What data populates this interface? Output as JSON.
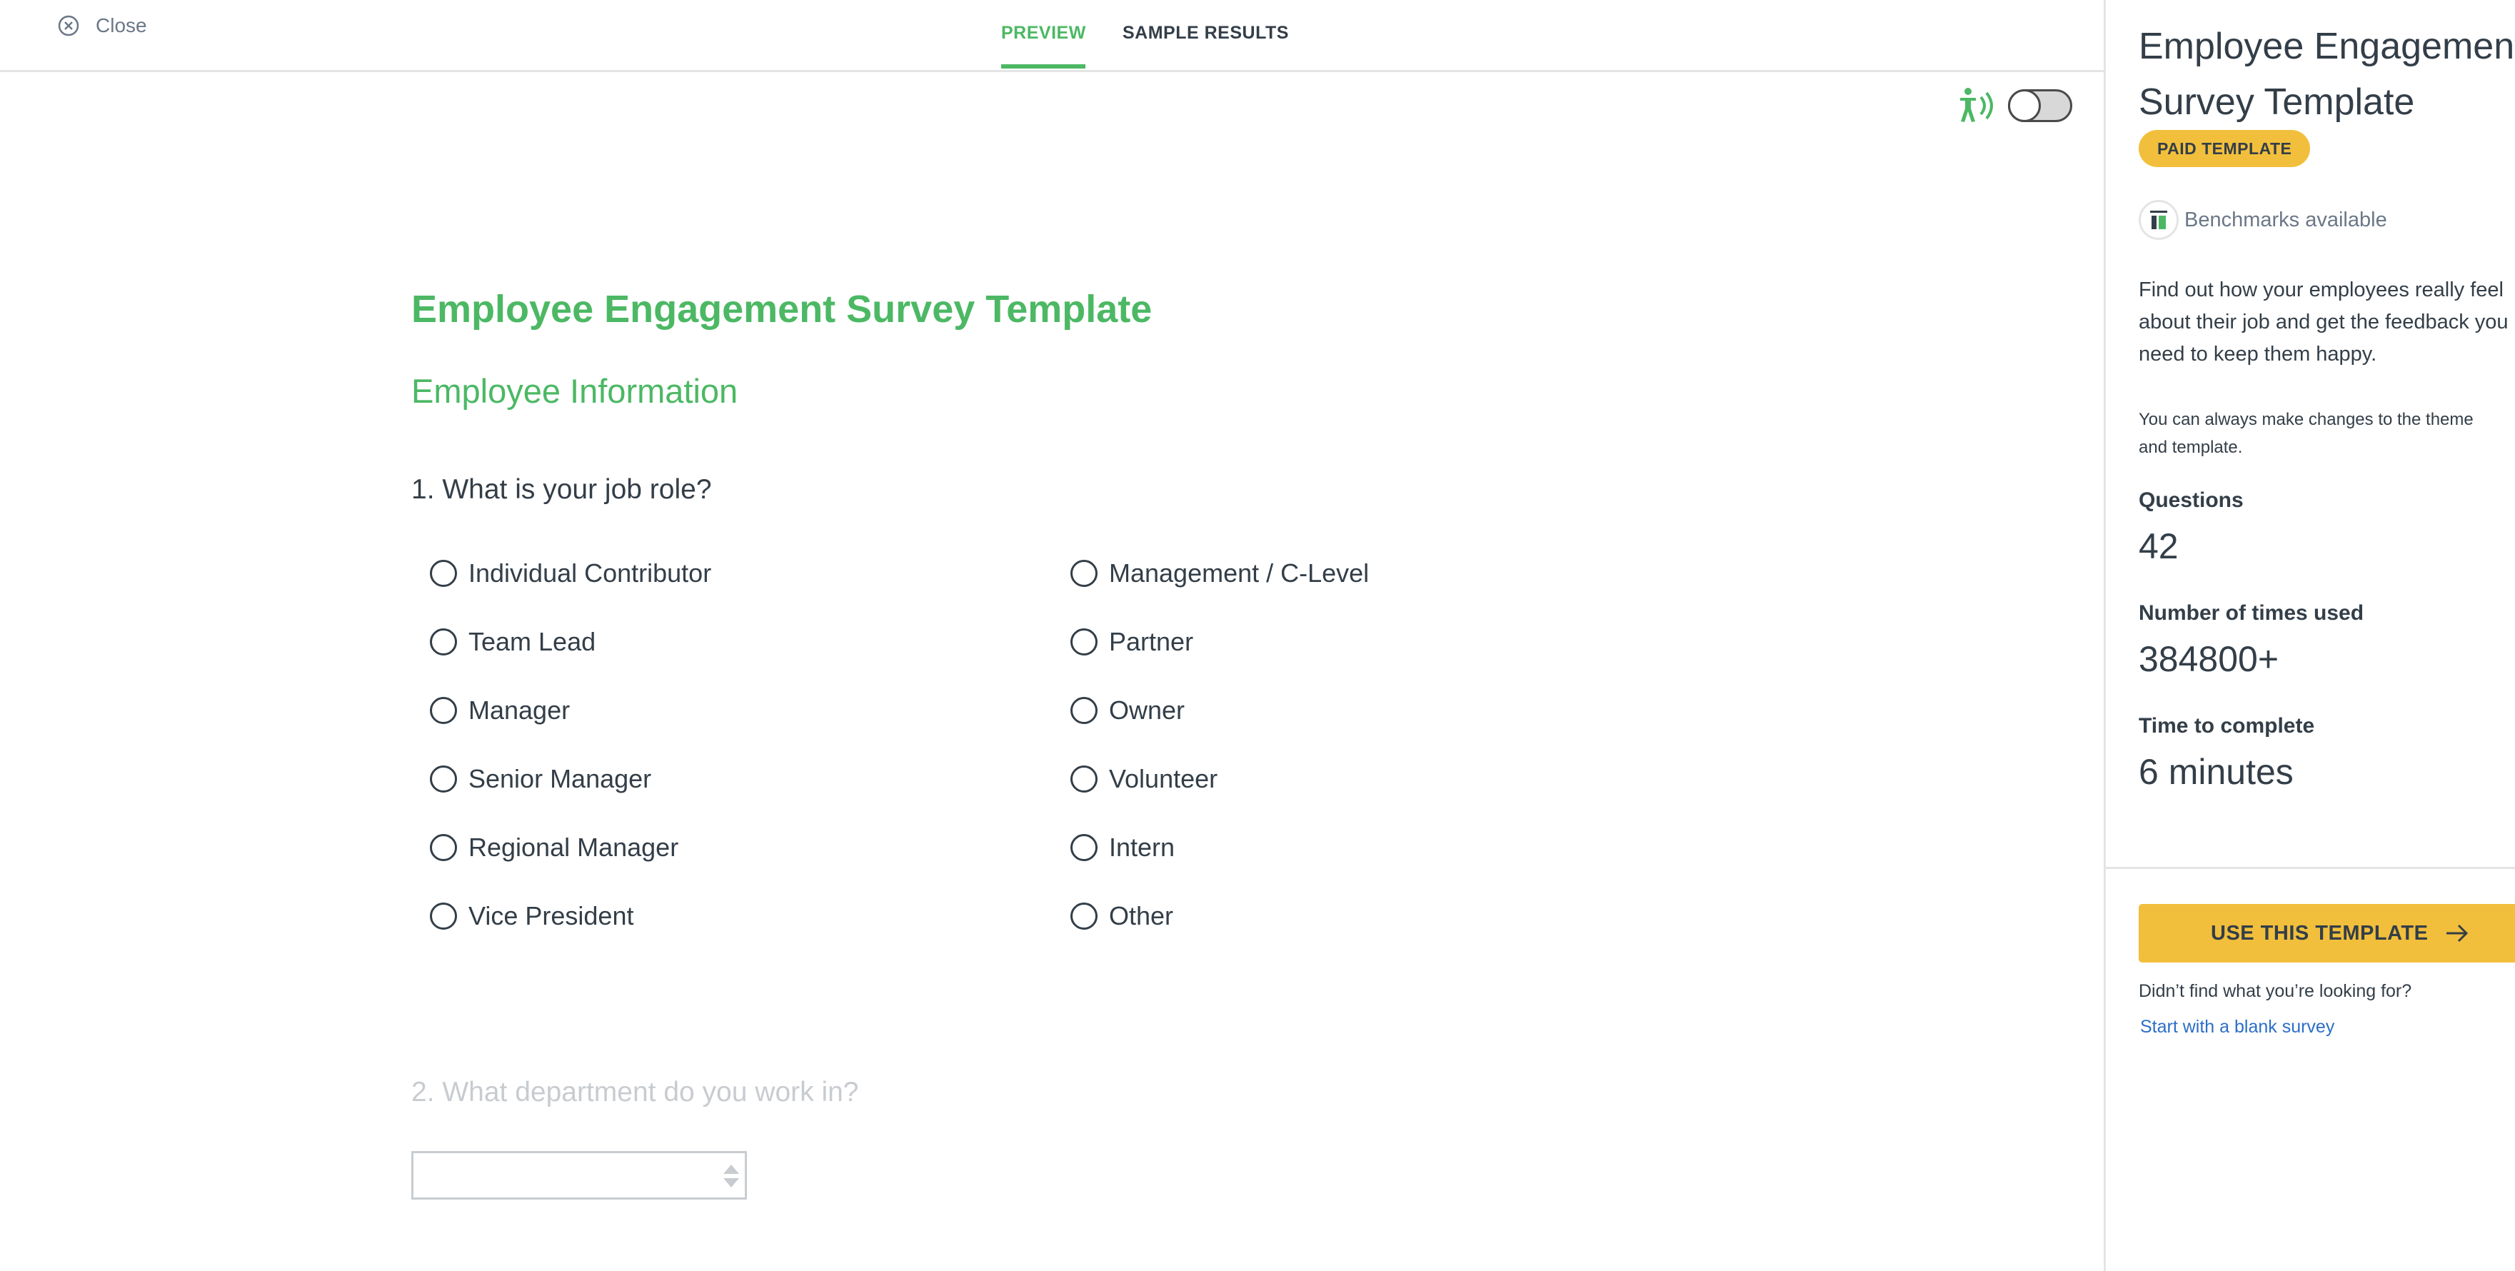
{
  "header": {
    "close_label": "Close",
    "tabs": [
      {
        "label": "PREVIEW",
        "active": true
      },
      {
        "label": "SAMPLE RESULTS",
        "active": false
      }
    ]
  },
  "accessibility": {
    "icon": "accessibility-icon",
    "toggle_on": false
  },
  "survey": {
    "title": "Employee Engagement Survey Template",
    "page_title": "Employee Information",
    "question1": {
      "text": "1. What is your job role?",
      "choices_left": [
        "Individual Contributor",
        "Team Lead",
        "Manager",
        "Senior Manager",
        "Regional Manager",
        "Vice President"
      ],
      "choices_right": [
        "Management / C-Level",
        "Partner",
        "Owner",
        "Volunteer",
        "Intern",
        "Other"
      ]
    },
    "question2": {
      "text": "2. What department do you work in?",
      "selected": ""
    }
  },
  "panel": {
    "title_line1": "Employee Engagement",
    "title_line2": "Survey Template",
    "badge": "PAID TEMPLATE",
    "benchmarks": "Benchmarks available",
    "description_lines": [
      "Find out how your employees really feel",
      "about their job and get the feedback you",
      "need to keep them happy."
    ],
    "note_lines": [
      "You can always make changes to the theme",
      "and template."
    ],
    "stats": [
      {
        "label": "Questions",
        "value": "42"
      },
      {
        "label": "Number of times used",
        "value": "384800+"
      },
      {
        "label": "Time to complete",
        "value": "6 minutes"
      }
    ],
    "use_button": "USE THIS TEMPLATE",
    "not_found": "Didn’t find what you’re looking for?",
    "blank_link": "Start with a blank survey"
  },
  "colors": {
    "accent_green": "#4cb864",
    "accent_yellow": "#f2bf3c",
    "text": "#333e48",
    "link": "#2c6ec8"
  }
}
